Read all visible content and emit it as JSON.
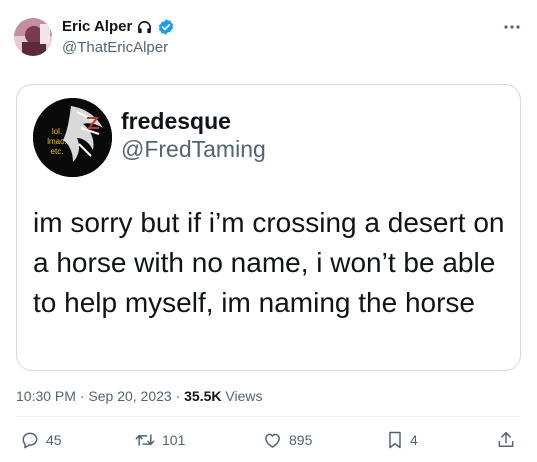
{
  "author": {
    "name": "Eric Alper",
    "handle": "@ThatEricAlper",
    "name_emoji_icon": "headphones-icon",
    "verified_icon": "verified-badge-icon",
    "verified_color": "#1d9bf0"
  },
  "quoted_tweet": {
    "name": "fredesque",
    "handle": "@FredTaming",
    "text": "im sorry but if i’m crossing a desert on a horse with no name, i won’t be able to help myself, im naming the horse",
    "avatar_caption": [
      "lol.",
      "lmao.",
      "etc."
    ]
  },
  "meta": {
    "time": "10:30 PM",
    "separator": "·",
    "date": "Sep 20, 2023",
    "views_count": "35.5K",
    "views_label": "Views"
  },
  "actions": {
    "replies": "45",
    "retweets": "101",
    "likes": "895",
    "bookmarks": "4"
  },
  "colors": {
    "text_primary": "#0f1419",
    "text_secondary": "#536471",
    "border": "#cfd9de",
    "accent": "#1d9bf0"
  }
}
